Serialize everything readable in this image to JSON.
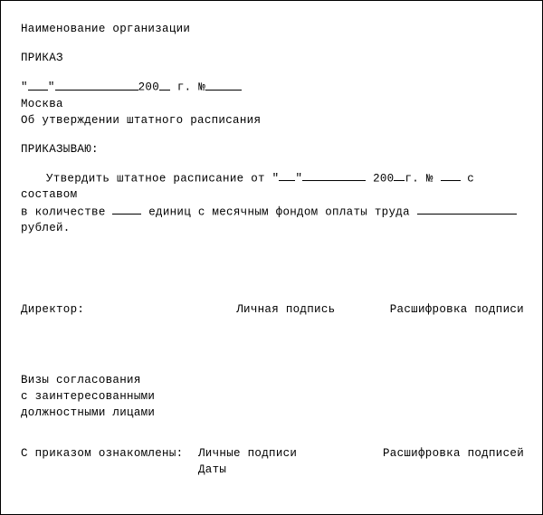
{
  "header": {
    "org_label": "Наименование организации",
    "doc_type": "ПРИКАЗ",
    "date_line_open_q": "\"",
    "date_line_close_q": "\"",
    "date_year_prefix": "200",
    "date_year_suffix": " г.  №",
    "city": "Москва",
    "subject": "Об утверждении штатного расписания"
  },
  "order": {
    "verb": "ПРИКАЗЫВАЮ:",
    "body_1_a": "Утвердить штатное расписание от \"",
    "body_1_b": "\"",
    "body_1_c": " 200",
    "body_1_d": "г. № ",
    "body_1_e": " с составом",
    "body_2_a": "в количестве ",
    "body_2_b": " единиц с месячным фондом оплаты труда ",
    "body_3": "рублей."
  },
  "sign": {
    "role": "Директор:",
    "col2": "Личная подпись",
    "col3": "Расшифровка подписи"
  },
  "visa": {
    "l1": "Визы согласования",
    "l2": "с заинтересованными",
    "l3": "должностными лицами"
  },
  "ack": {
    "l1": "С приказом ознакомлены:",
    "c2a": "Личные подписи",
    "c2b": "Даты",
    "c3": "Расшифровка подписей"
  }
}
